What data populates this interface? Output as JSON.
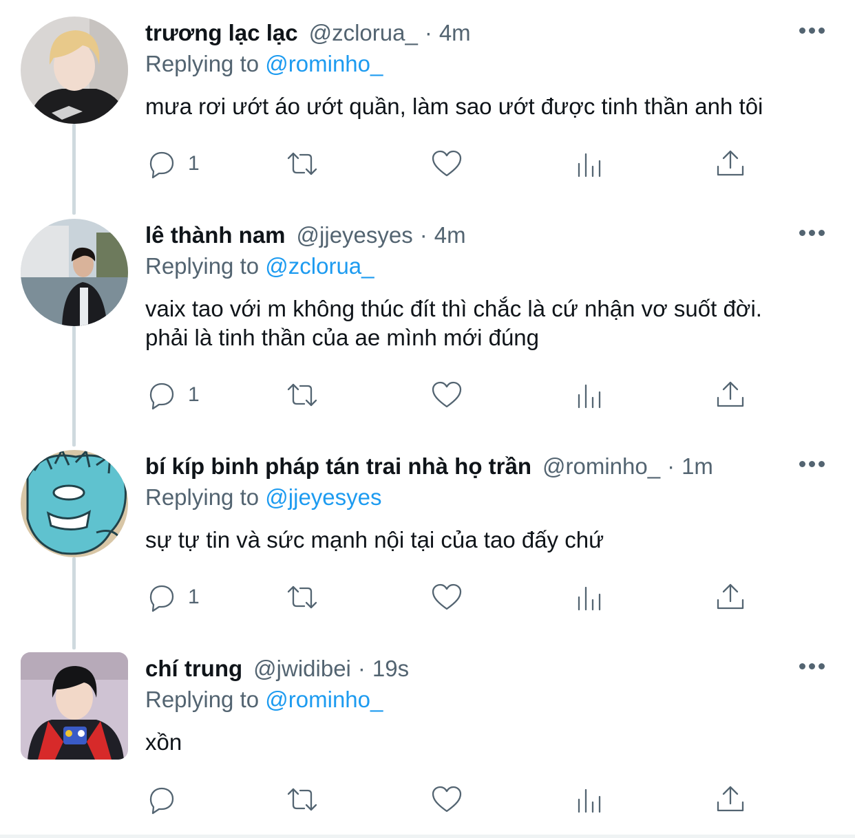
{
  "tweets": [
    {
      "name": "trương lạc lạc",
      "handle": "@zclorua_",
      "dot": "·",
      "time": "4m",
      "replying_label": "Replying to",
      "replying_to": "@rominho_",
      "body": "mưa rơi ướt áo ướt quần, làm sao ướt được tinh thần anh tôi",
      "reply_count": "1"
    },
    {
      "name": "lê thành nam",
      "handle": "@jjeyesyes",
      "dot": "·",
      "time": "4m",
      "replying_label": "Replying to",
      "replying_to": "@zclorua_",
      "body": "vaix tao với m không thúc đít thì chắc là cứ nhận vơ suốt đời. phải là tinh thần của ae mình mới đúng",
      "reply_count": "1"
    },
    {
      "name": "bí kíp binh pháp tán trai nhà họ trần",
      "handle": "@rominho_",
      "dot": "·",
      "time": "1m",
      "replying_label": "Replying to",
      "replying_to": "@jjeyesyes",
      "body": "sự tự tin và sức mạnh nội tại của tao đấy chứ",
      "reply_count": "1"
    },
    {
      "name": "chí trung",
      "handle": "@jwidibei",
      "dot": "·",
      "time": "19s",
      "replying_label": "Replying to",
      "replying_to": "@rominho_",
      "body": "xồn",
      "reply_count": ""
    }
  ],
  "icons": {
    "reply": "reply-icon",
    "retweet": "retweet-icon",
    "like": "heart-icon",
    "analytics": "analytics-icon",
    "share": "share-icon",
    "more": "more-dots-icon"
  },
  "colors": {
    "link": "#1d9bf0",
    "secondary_text": "#536471",
    "primary_text": "#0f1419",
    "thread_line": "#cfd9de"
  }
}
